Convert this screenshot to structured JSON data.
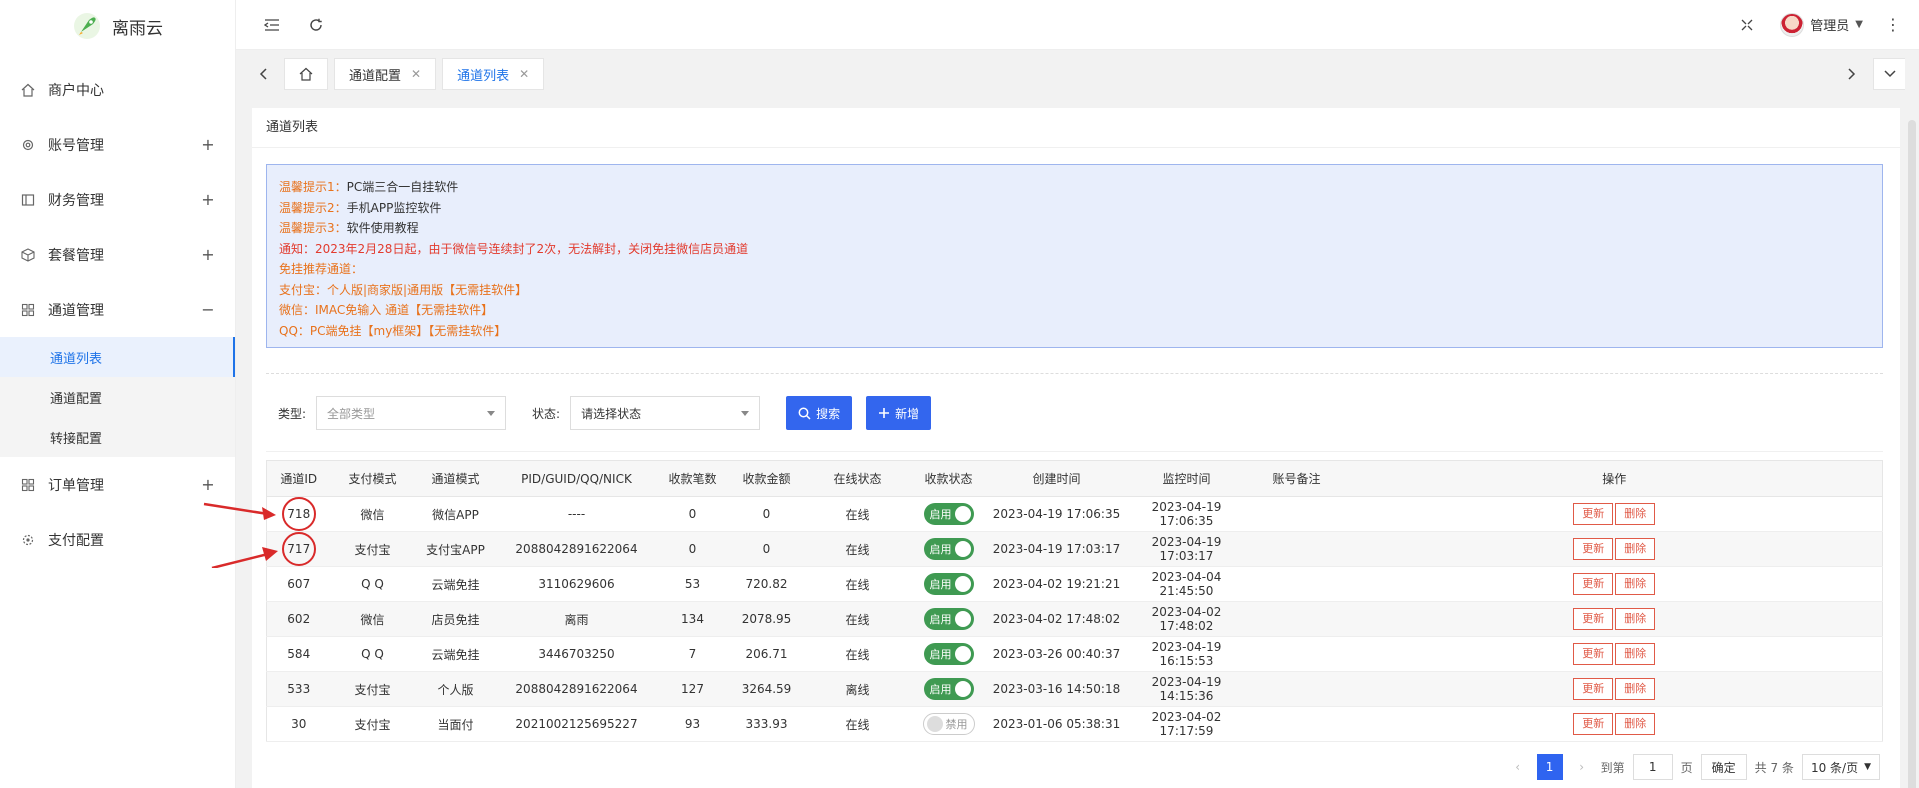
{
  "app": {
    "name": "离雨云"
  },
  "sidebar": {
    "items": [
      {
        "label": "商户中心",
        "expander": ""
      },
      {
        "label": "账号管理",
        "expander": "+"
      },
      {
        "label": "财务管理",
        "expander": "+"
      },
      {
        "label": "套餐管理",
        "expander": "+"
      },
      {
        "label": "通道管理",
        "expander": "−"
      },
      {
        "label": "订单管理",
        "expander": "+"
      },
      {
        "label": "支付配置",
        "expander": ""
      }
    ],
    "sub": [
      "通道列表",
      "通道配置",
      "转接配置"
    ]
  },
  "header": {
    "user": "管理员"
  },
  "tabs": [
    "通道配置",
    "通道列表"
  ],
  "page": {
    "title": "通道列表"
  },
  "notice": {
    "l1k": "温馨提示1：",
    "l1v": "PC端三合一自挂软件",
    "l2k": "温馨提示2：",
    "l2v": "手机APP监控软件",
    "l3k": "温馨提示3：",
    "l3v": "软件使用教程",
    "l4": "通知：2023年2月28日起，由于微信号连续封了2次，无法解封，关闭免挂微信店员通道",
    "l5": "免挂推荐通道：",
    "l6": "支付宝：个人版|商家版|通用版【无需挂软件】",
    "l7": "微信：IMAC免输入 通道【无需挂软件】",
    "l8": "QQ：PC端免挂【my框架】【无需挂软件】"
  },
  "filters": {
    "type_label": "类型:",
    "type_value": "全部类型",
    "status_label": "状态:",
    "status_value": "请选择状态",
    "search_btn": "搜索",
    "add_btn": "新增"
  },
  "table": {
    "headers": [
      "通道ID",
      "支付模式",
      "通道模式",
      "PID/GUID/QQ/NICK",
      "收款笔数",
      "收款金额",
      "在线状态",
      "收款状态",
      "创建时间",
      "监控时间",
      "账号备注",
      "操作"
    ],
    "rows": [
      {
        "id": "718",
        "pay": "微信",
        "mode": "微信APP",
        "pid": "----",
        "cnt": "0",
        "amt": "0",
        "online": "在线",
        "recv": "启用",
        "created": "2023-04-19 17:06:35",
        "monitor": "2023-04-19 17:06:35",
        "note": ""
      },
      {
        "id": "717",
        "pay": "支付宝",
        "mode": "支付宝APP",
        "pid": "2088042891622064",
        "cnt": "0",
        "amt": "0",
        "online": "在线",
        "recv": "启用",
        "created": "2023-04-19 17:03:17",
        "monitor": "2023-04-19 17:03:17",
        "note": ""
      },
      {
        "id": "607",
        "pay": "Q Q",
        "mode": "云端免挂",
        "pid": "3110629606",
        "cnt": "53",
        "amt": "720.82",
        "online": "在线",
        "recv": "启用",
        "created": "2023-04-02 19:21:21",
        "monitor": "2023-04-04 21:45:50",
        "note": ""
      },
      {
        "id": "602",
        "pay": "微信",
        "mode": "店员免挂",
        "pid": "离雨",
        "cnt": "134",
        "amt": "2078.95",
        "online": "在线",
        "recv": "启用",
        "created": "2023-04-02 17:48:02",
        "monitor": "2023-04-02 17:48:02",
        "note": ""
      },
      {
        "id": "584",
        "pay": "Q Q",
        "mode": "云端免挂",
        "pid": "3446703250",
        "cnt": "7",
        "amt": "206.71",
        "online": "在线",
        "recv": "启用",
        "created": "2023-03-26 00:40:37",
        "monitor": "2023-04-19 16:15:53",
        "note": ""
      },
      {
        "id": "533",
        "pay": "支付宝",
        "mode": "个人版",
        "pid": "2088042891622064",
        "cnt": "127",
        "amt": "3264.59",
        "online": "离线",
        "recv": "启用",
        "created": "2023-03-16 14:50:18",
        "monitor": "2023-04-19 14:15:36",
        "note": ""
      },
      {
        "id": "30",
        "pay": "支付宝",
        "mode": "当面付",
        "pid": "2021002125695227",
        "cnt": "93",
        "amt": "333.93",
        "online": "在线",
        "recv": "禁用",
        "created": "2023-01-06 05:38:31",
        "monitor": "2023-04-02 17:17:59",
        "note": ""
      }
    ],
    "update_btn": "更新",
    "delete_btn": "删除"
  },
  "pager": {
    "page": "1",
    "goto_label": "到第",
    "goto_value": "1",
    "page_unit": "页",
    "ok": "确定",
    "total": "共 7 条",
    "size": "10 条/页"
  },
  "colors": {
    "primary": "#3366ee",
    "online": "#16a34a",
    "offline": "#e23b2e",
    "warn": "#e8721c"
  }
}
